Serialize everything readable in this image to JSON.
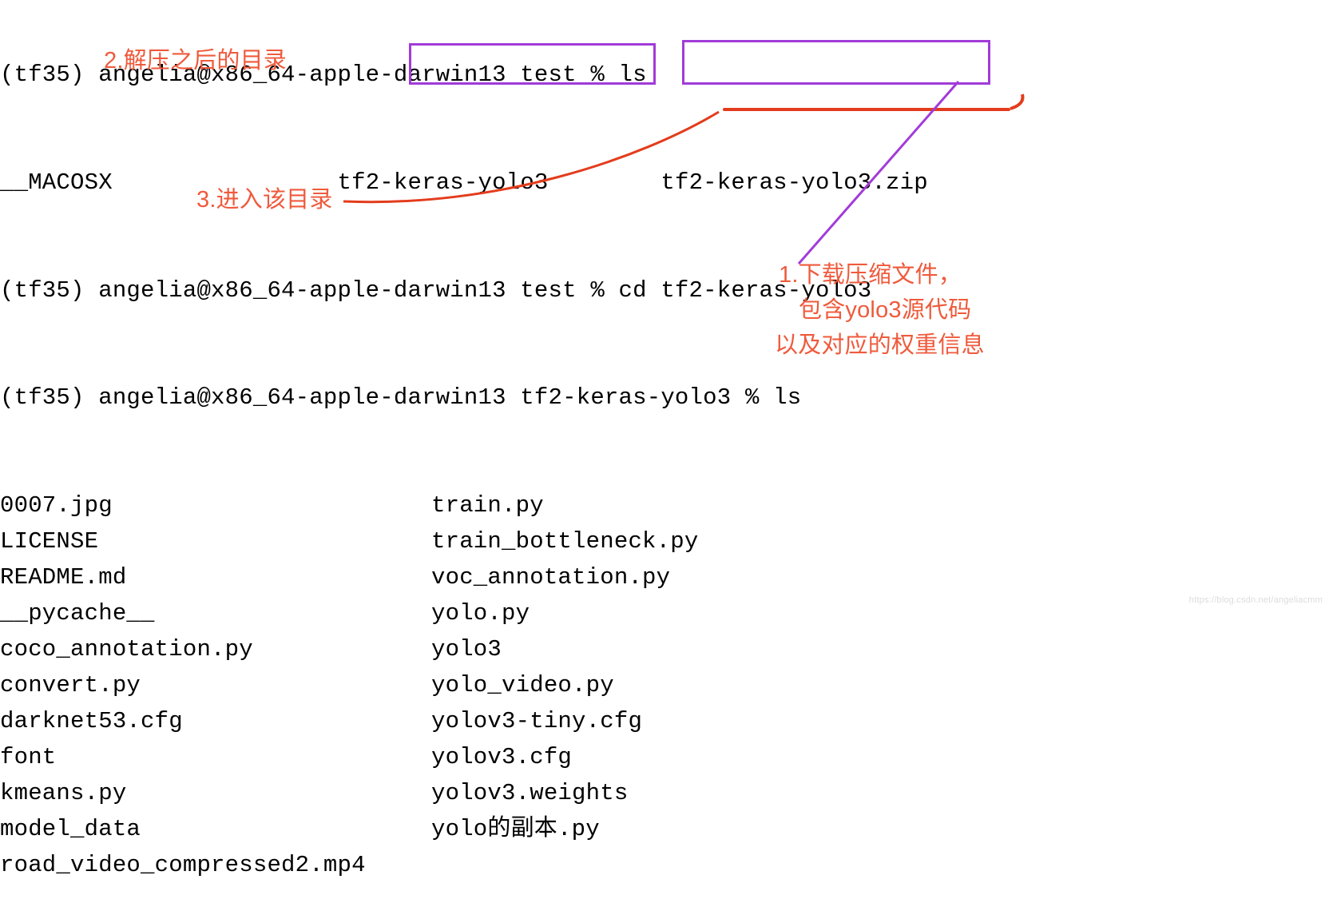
{
  "prompt1": "(tf35) angelia@x86_64-apple-darwin13 test % ls",
  "ls1": {
    "col1": "__MACOSX",
    "col2": "tf2-keras-yolo3",
    "col3": "tf2-keras-yolo3.zip"
  },
  "prompt2": "(tf35) angelia@x86_64-apple-darwin13 test % cd tf2-keras-yolo3",
  "prompt3": "(tf35) angelia@x86_64-apple-darwin13 tf2-keras-yolo3 % ls",
  "ls2": {
    "left": [
      "0007.jpg",
      "LICENSE",
      "README.md",
      "__pycache__",
      "coco_annotation.py",
      "convert.py",
      "darknet53.cfg",
      "font",
      "kmeans.py",
      "model_data",
      "road_video_compressed2.mp4"
    ],
    "right": [
      "train.py",
      "train_bottleneck.py",
      "voc_annotation.py",
      "yolo.py",
      "yolo3",
      "yolo_video.py",
      "yolov3-tiny.cfg",
      "yolov3.cfg",
      "yolov3.weights",
      "yolo的副本.py"
    ]
  },
  "annot": {
    "n2": "2.解压之后的目录",
    "n3": "3.进入该目录",
    "n1a": "1.下载压缩文件，",
    "n1b": "包含yolo3源代码",
    "n1c": "以及对应的权重信息"
  },
  "watermark": "https://blog.csdn.net/angeliacmm"
}
